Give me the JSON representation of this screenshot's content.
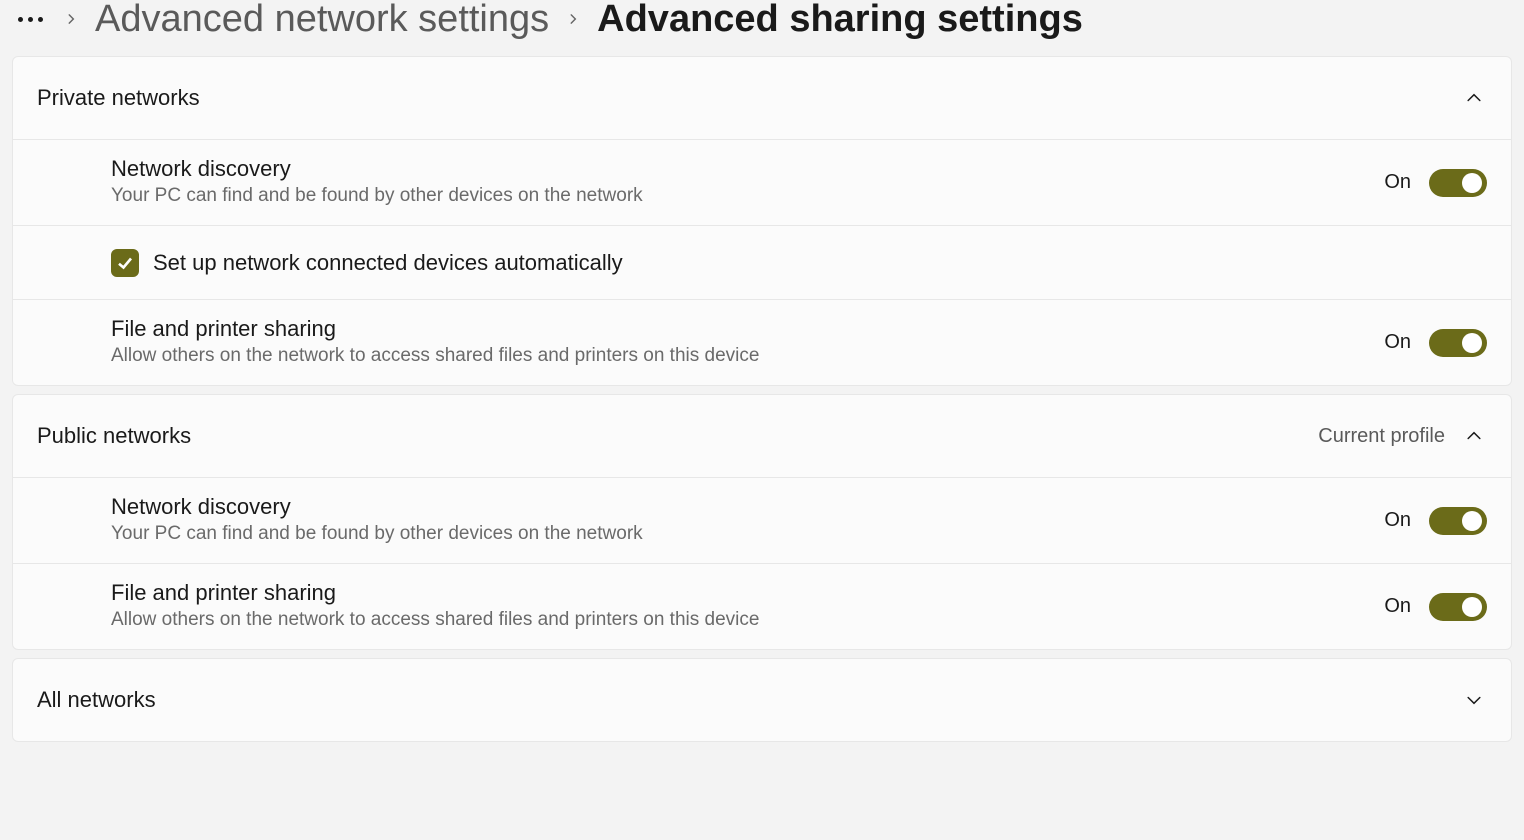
{
  "breadcrumb": {
    "parent": "Advanced network settings",
    "current": "Advanced sharing settings"
  },
  "sections": {
    "private": {
      "title": "Private networks",
      "network_discovery": {
        "title": "Network discovery",
        "desc": "Your PC can find and be found by other devices on the network",
        "state": "On"
      },
      "auto_setup": {
        "label": "Set up network connected devices automatically",
        "checked": true
      },
      "file_sharing": {
        "title": "File and printer sharing",
        "desc": "Allow others on the network to access shared files and printers on this device",
        "state": "On"
      }
    },
    "public": {
      "title": "Public networks",
      "badge": "Current profile",
      "network_discovery": {
        "title": "Network discovery",
        "desc": "Your PC can find and be found by other devices on the network",
        "state": "On"
      },
      "file_sharing": {
        "title": "File and printer sharing",
        "desc": "Allow others on the network to access shared files and printers on this device",
        "state": "On"
      }
    },
    "all": {
      "title": "All networks"
    }
  }
}
